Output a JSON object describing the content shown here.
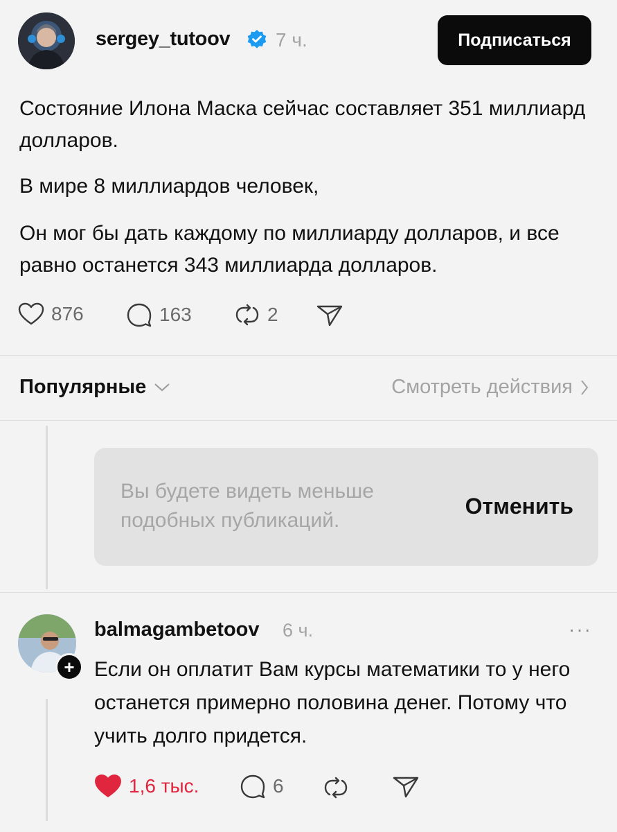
{
  "post": {
    "author": "sergey_tutoov",
    "time": "7 ч.",
    "subscribe_label": "Подписаться",
    "paragraphs": [
      "Состояние Илона Маска сейчас составляет 351 миллиард долларов.",
      "В мире 8 миллиардов человек,",
      "Он мог бы дать каждому по миллиарду долларов, и все равно останется 343 миллиарда долларов."
    ],
    "likes": "876",
    "comments": "163",
    "reposts": "2"
  },
  "sort": {
    "label": "Популярные",
    "activity_link": "Смотреть действия"
  },
  "notice": {
    "text": "Вы будете видеть меньше подобных публикаций.",
    "undo_label": "Отменить"
  },
  "reply": {
    "author": "balmagambetoov",
    "time": "6 ч.",
    "more": "···",
    "follow_symbol": "+",
    "text": "Если он оплатит Вам курсы математики то у него останется примерно половина денег. Потому что учить долго придется.",
    "likes": "1,6 тыс.",
    "comments": "6"
  },
  "colors": {
    "background": "#f3f3f3",
    "verified": "#1d9bf0",
    "liked": "#e0263f",
    "button": "#0b0b0b"
  },
  "icons": [
    "heart-icon",
    "comment-icon",
    "repost-icon",
    "share-icon",
    "chevron-down-icon",
    "chevron-right-icon",
    "verified-icon",
    "more-icon",
    "plus-icon"
  ]
}
